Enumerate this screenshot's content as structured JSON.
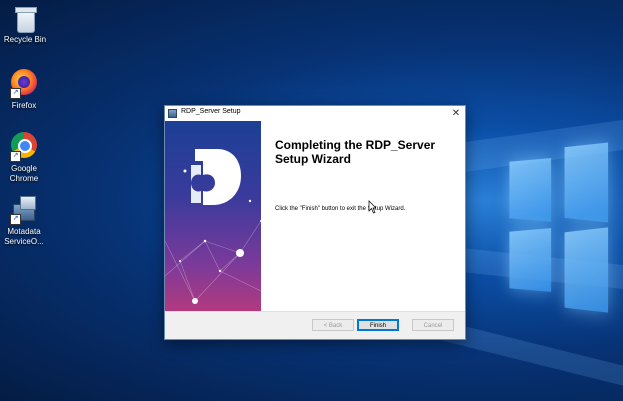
{
  "desktop": {
    "icons": [
      {
        "label": "Recycle Bin",
        "icon": "recycle-bin-icon"
      },
      {
        "label": "Firefox",
        "icon": "firefox-icon"
      },
      {
        "label": "Google Chrome",
        "icon": "chrome-icon"
      },
      {
        "label": "Motadata ServiceO...",
        "icon": "installer-icon"
      }
    ]
  },
  "dialog": {
    "title": "RDP_Server Setup",
    "heading": "Completing the RDP_Server Setup Wizard",
    "message": "Click the \"Finish\" button to exit the Setup Wizard.",
    "buttons": {
      "back": "< Back",
      "finish": "Finish",
      "cancel": "Cancel"
    },
    "close_glyph": "✕"
  },
  "colors": {
    "banner_top": "#1c3f95",
    "banner_bottom": "#b23a7f",
    "default_button_border": "#0078d7"
  }
}
